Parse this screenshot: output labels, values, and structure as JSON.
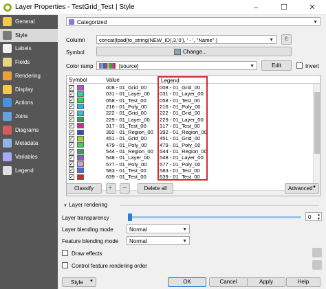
{
  "window": {
    "title": "Layer Properties - TestGrid_Test | Style",
    "minimize": "–",
    "maximize": "☐",
    "close": "✕"
  },
  "sidebar": {
    "items": [
      {
        "label": "General",
        "icon": "info-icon",
        "color": "#f2c94c",
        "active": false
      },
      {
        "label": "Style",
        "icon": "paintbrush-icon",
        "color": "#7a7a7a",
        "active": true
      },
      {
        "label": "Labels",
        "icon": "labels-icon",
        "color": "#f2f2f2",
        "active": false
      },
      {
        "label": "Fields",
        "icon": "fields-icon",
        "color": "#e8d486",
        "active": false
      },
      {
        "label": "Rendering",
        "icon": "rendering-icon",
        "color": "#e6a23c",
        "active": false
      },
      {
        "label": "Display",
        "icon": "display-icon",
        "color": "#f2c94c",
        "active": false
      },
      {
        "label": "Actions",
        "icon": "actions-icon",
        "color": "#4a90e2",
        "active": false
      },
      {
        "label": "Joins",
        "icon": "joins-icon",
        "color": "#6aa0e0",
        "active": false
      },
      {
        "label": "Diagrams",
        "icon": "diagrams-icon",
        "color": "#d65c5c",
        "active": false
      },
      {
        "label": "Metadata",
        "icon": "metadata-icon",
        "color": "#8fb4e8",
        "active": false
      },
      {
        "label": "Variables",
        "icon": "variables-icon",
        "color": "#a8a8ff",
        "active": false
      },
      {
        "label": "Legend",
        "icon": "legend-icon",
        "color": "#e0e0e0",
        "active": false
      }
    ]
  },
  "renderer": {
    "type": "Categorized",
    "column_label": "Column",
    "column_value": "concat(lpad(to_string(NEW_ID),3,'0'), ' - ', \"Name\" )",
    "expression_button": "ε",
    "symbol_label": "Symbol",
    "symbol_button": "Change...",
    "symbol_color": "#8aa8b8",
    "color_ramp_label": "Color ramp",
    "color_ramp_value": "[source]",
    "edit_button": "Edit",
    "invert_label": "Invert"
  },
  "table": {
    "headers": {
      "symbol": "Symbol",
      "value": "Value",
      "legend": "Legend"
    },
    "rows": [
      {
        "value": "008 - 01_Grid_00",
        "legend": "008 - 01_Grid_00",
        "color": "#b84fd6"
      },
      {
        "value": "031 - 01_Layer_00",
        "legend": "031 - 01_Layer_00",
        "color": "#2ad1a8"
      },
      {
        "value": "058 - 01_Test_00",
        "legend": "058 - 01_Test_00",
        "color": "#2fd44a"
      },
      {
        "value": "216 - 01_Poly_00",
        "legend": "216 - 01_Poly_00",
        "color": "#1fb8e8"
      },
      {
        "value": "222 - 01_Grid_00",
        "legend": "222 - 01_Grid_00",
        "color": "#2ec2d6"
      },
      {
        "value": "229 - 01_Layer_00",
        "legend": "229 - 01_Layer_00",
        "color": "#2fa05a"
      },
      {
        "value": "317 - 01_Test_00",
        "legend": "317 - 01_Test_00",
        "color": "#d42a8f"
      },
      {
        "value": "392 - 01_Region_00",
        "legend": "392 - 01_Region_00",
        "color": "#2e4fb8"
      },
      {
        "value": "451 - 01_Grid_00",
        "legend": "451 - 01_Grid_00",
        "color": "#9ad42a"
      },
      {
        "value": "479 - 01_Poly_00",
        "legend": "479 - 01_Poly_00",
        "color": "#44c85a"
      },
      {
        "value": "544 - 01_Region_00",
        "legend": "544 - 01_Region_00",
        "color": "#3a9e6a"
      },
      {
        "value": "548 - 01_Layer_00",
        "legend": "548 - 01_Layer_00",
        "color": "#8a5ad6"
      },
      {
        "value": "577 - 01_Poly_00",
        "legend": "577 - 01_Poly_00",
        "color": "#d6a0e8"
      },
      {
        "value": "583 - 01_Test_00",
        "legend": "583 - 01_Test_00",
        "color": "#4a6ee0"
      },
      {
        "value": "639 - 01_Test_00",
        "legend": "639 - 01_Test_00",
        "color": "#d42a2a"
      }
    ],
    "legend_highlight_color": "#d62b2b"
  },
  "actions": {
    "classify": "Classify",
    "delete_all": "Delete all",
    "advanced": "Advanced"
  },
  "layer_rendering": {
    "title": "Layer rendering",
    "transparency_label": "Layer transparency",
    "transparency_value": "0",
    "blending_label": "Layer blending mode",
    "blending_value": "Normal",
    "feature_blending_label": "Feature blending mode",
    "feature_blending_value": "Normal",
    "draw_effects_label": "Draw effects",
    "control_order_label": "Control feature rendering order"
  },
  "footer": {
    "style": "Style",
    "ok": "OK",
    "cancel": "Cancel",
    "apply": "Apply",
    "help": "Help"
  },
  "colors": {
    "sidebar_bg": "#565656",
    "accent": "#2a7fd4"
  }
}
